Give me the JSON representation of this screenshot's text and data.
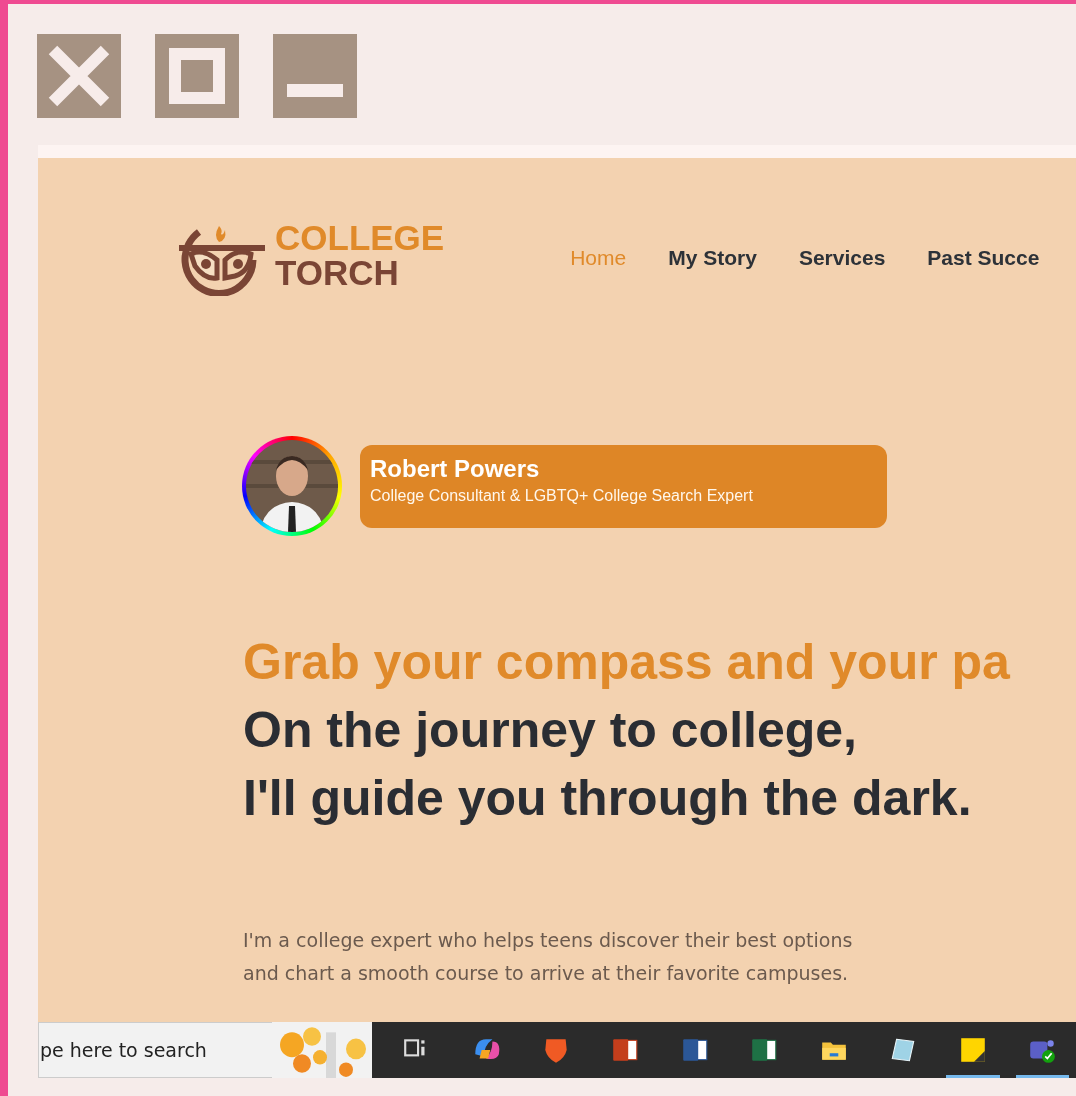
{
  "window_controls": [
    {
      "kind": "close"
    },
    {
      "kind": "maximize"
    },
    {
      "kind": "minimize"
    }
  ],
  "site": {
    "logo": {
      "line_1": "COLLEGE",
      "line_2": "TORCH"
    },
    "nav": [
      {
        "label": "Home",
        "selected": true
      },
      {
        "label": "My Story",
        "selected": false
      },
      {
        "label": "Services",
        "selected": false
      },
      {
        "label": "Past Succe",
        "selected": false
      }
    ],
    "profile": {
      "name": "Robert Powers",
      "title": "College Consultant &  LGBTQ+ College Search Expert"
    },
    "headline": {
      "accent": "Grab your compass and your pa",
      "lines": [
        "On the journey to college,",
        "I'll guide you through the dark."
      ]
    },
    "intro": [
      "I'm a college expert who helps teens discover their best options",
      "and chart a smooth course to arrive at their favorite campuses."
    ]
  },
  "taskbar": {
    "search": {
      "placeholder": "pe here to search"
    },
    "apps": [
      {
        "kind": "taskview",
        "running": false
      },
      {
        "kind": "copilot",
        "running": false
      },
      {
        "kind": "shield",
        "running": false
      },
      {
        "kind": "slides",
        "running": false
      },
      {
        "kind": "document",
        "running": false
      },
      {
        "kind": "spreadsheet",
        "running": false
      },
      {
        "kind": "folder",
        "running": false
      },
      {
        "kind": "notepad",
        "running": false
      },
      {
        "kind": "sticky",
        "running": true
      },
      {
        "kind": "chat",
        "running": true
      }
    ]
  }
}
